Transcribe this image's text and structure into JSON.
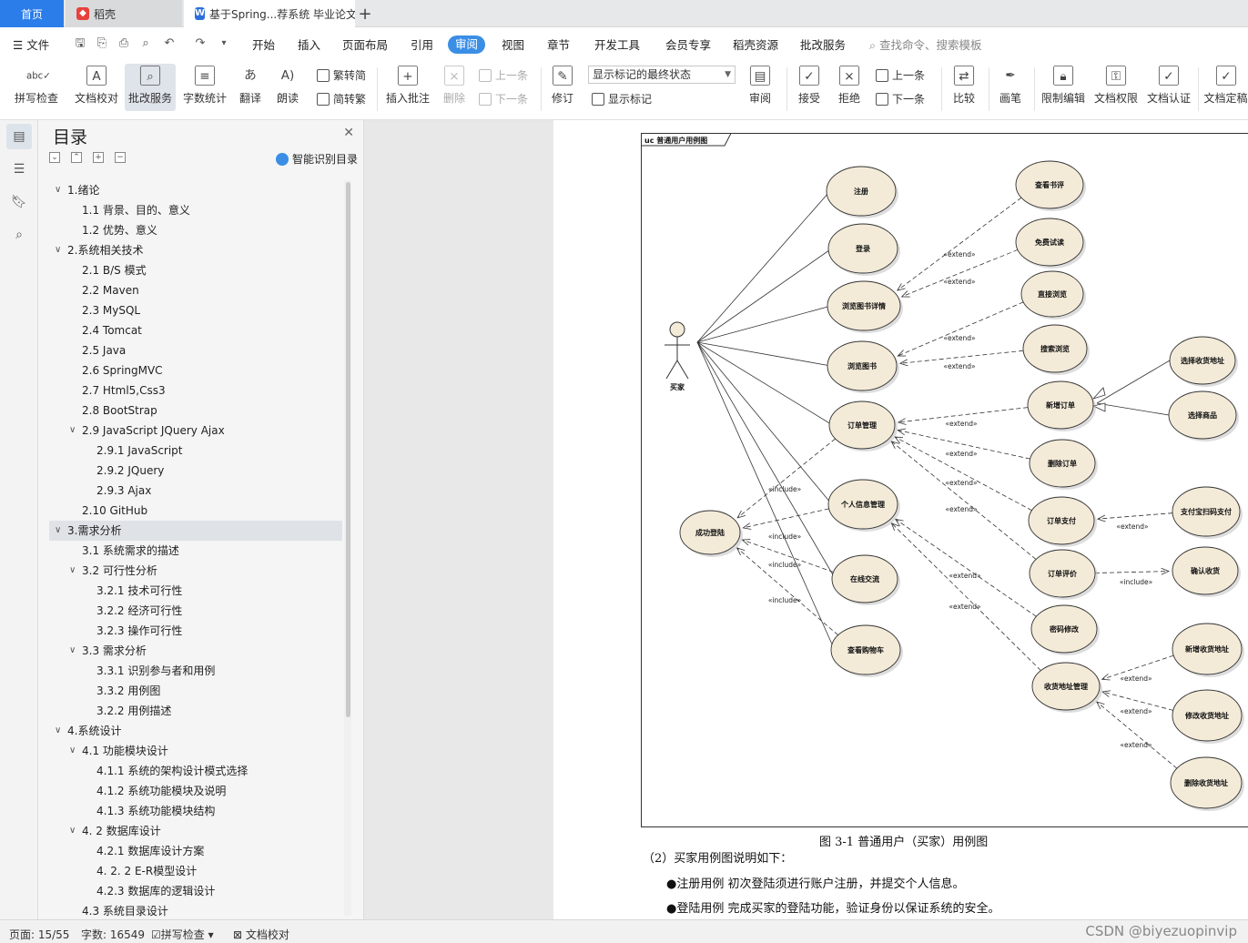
{
  "tabs": {
    "home": "首页",
    "daoke": "稻壳",
    "doc": "基于Spring...荐系统 毕业论文",
    "new": "+"
  },
  "menu": {
    "file": "文件",
    "items": [
      "开始",
      "插入",
      "页面布局",
      "引用",
      "审阅",
      "视图",
      "章节",
      "开发工具",
      "会员专享",
      "稻壳资源",
      "批改服务"
    ],
    "search": "查找命令、搜索模板"
  },
  "ribbon": {
    "spellcheck": "拼写检查",
    "doc_check": "文档校对",
    "grading": "批改服务",
    "word_count": "字数统计",
    "translate": "翻译",
    "read_aloud": "朗读",
    "trad": "繁转简",
    "simp": "简转繁",
    "insert_comment": "插入批注",
    "delete": "删除",
    "prev_comment": "上一条",
    "next_comment": "下一条",
    "revise": "修订",
    "mark_state": "显示标记的最终状态",
    "show_marks": "显示标记",
    "review": "审阅",
    "accept": "接受",
    "reject": "拒绝",
    "prev_change": "上一条",
    "next_change": "下一条",
    "compare": "比较",
    "pen": "画笔",
    "restrict": "限制编辑",
    "permission": "文档权限",
    "certify": "文档认证",
    "finalize": "文档定稿"
  },
  "nav": {
    "title": "目录",
    "smart_toc": "智能识别目录",
    "items": [
      {
        "label": "1.绪论",
        "level": 1,
        "chevron": true
      },
      {
        "label": "1.1  背景、目的、意义",
        "level": 2
      },
      {
        "label": "1.2  优势、意义",
        "level": 2
      },
      {
        "label": "2.系统相关技术",
        "level": 1,
        "chevron": true
      },
      {
        "label": "2.1 B/S 模式",
        "level": 2
      },
      {
        "label": "2.2 Maven",
        "level": 2
      },
      {
        "label": "2.3 MySQL",
        "level": 2
      },
      {
        "label": "2.4 Tomcat",
        "level": 2
      },
      {
        "label": "2.5 Java",
        "level": 2
      },
      {
        "label": "2.6 SpringMVC",
        "level": 2
      },
      {
        "label": "2.7 Html5,Css3",
        "level": 2
      },
      {
        "label": "2.8 BootStrap",
        "level": 2
      },
      {
        "label": "2.9 JavaScript   JQuery   Ajax",
        "level": 2,
        "chevron": true
      },
      {
        "label": "2.9.1 JavaScript",
        "level": 3
      },
      {
        "label": "2.9.2 JQuery",
        "level": 3
      },
      {
        "label": "2.9.3 Ajax",
        "level": 3
      },
      {
        "label": "2.10 GitHub",
        "level": 2
      },
      {
        "label": "3.需求分析",
        "level": 1,
        "chevron": true,
        "highlight": true
      },
      {
        "label": "3.1  系统需求的描述",
        "level": 2
      },
      {
        "label": "3.2  可行性分析",
        "level": 2,
        "chevron": true
      },
      {
        "label": "3.2.1 技术可行性",
        "level": 3
      },
      {
        "label": "3.2.2 经济可行性",
        "level": 3
      },
      {
        "label": "3.2.3 操作可行性",
        "level": 3
      },
      {
        "label": "3.3  需求分析",
        "level": 2,
        "chevron": true
      },
      {
        "label": "3.3.1  识别参与者和用例",
        "level": 3
      },
      {
        "label": "3.3.2  用例图",
        "level": 3
      },
      {
        "label": "3.2.2 用例描述",
        "level": 3
      },
      {
        "label": "4.系统设计",
        "level": 1,
        "chevron": true
      },
      {
        "label": "4.1 功能模块设计",
        "level": 2,
        "chevron": true
      },
      {
        "label": "4.1.1 系统的架构设计模式选择",
        "level": 3
      },
      {
        "label": "4.1.2 系统功能模块及说明",
        "level": 3
      },
      {
        "label": "4.1.3 系统功能模块结构",
        "level": 3
      },
      {
        "label": "4. 2 数据库设计",
        "level": 2,
        "chevron": true
      },
      {
        "label": "4.2.1 数据库设计方案",
        "level": 3
      },
      {
        "label": "4. 2. 2 E-R模型设计",
        "level": 3
      },
      {
        "label": "4.2.3 数据库的逻辑设计",
        "level": 3
      },
      {
        "label": "4.3  系统目录设计",
        "level": 2
      }
    ]
  },
  "diagram": {
    "frame_label": "uc 普通用户用例图",
    "actor": "买家",
    "usecases": {
      "register": "注册",
      "login": "登录",
      "browse_detail": "浏览图书详情",
      "browse_books": "浏览图书",
      "order_mgmt": "订单管理",
      "profile": "个人信息管理",
      "chat": "在线交流",
      "cart": "查看购物车",
      "login_ok": "成功登陆",
      "view_review": "查看书评",
      "free_trial": "免费试读",
      "direct_browse": "直接浏览",
      "search_browse": "搜索浏览",
      "new_order": "新增订单",
      "choose_addr": "选择收货地址",
      "choose_goods": "选择商品",
      "delete_order": "删除订单",
      "pay_order": "订单支付",
      "alipay": "支付宝扫码支付",
      "review_order": "订单评价",
      "confirm_receipt": "确认收货",
      "change_pwd": "密码修改",
      "addr_mgmt": "收货地址管理",
      "add_addr": "新增收货地址",
      "edit_addr": "修改收货地址",
      "del_addr": "删除收货地址"
    },
    "extend": "«extend»",
    "include": "«include»"
  },
  "document": {
    "caption": "图 3-1  普通用户（买家）用例图",
    "line1": "（2）买家用例图说明如下：",
    "line2": "●注册用例   初次登陆须进行账户注册，并提交个人信息。",
    "line3": "●登陆用例   完成买家的登陆功能，验证身份以保证系统的安全。"
  },
  "status": {
    "page": "页面: 15/55",
    "words": "字数: 16549",
    "spell": "拼写检查",
    "proof": "文档校对",
    "watermark": "CSDN @biyezuopinvip"
  },
  "colors": {
    "accent": "#2b7de9",
    "usecase_fill": "#f3ead8",
    "highlight": "#dfe2e7"
  }
}
